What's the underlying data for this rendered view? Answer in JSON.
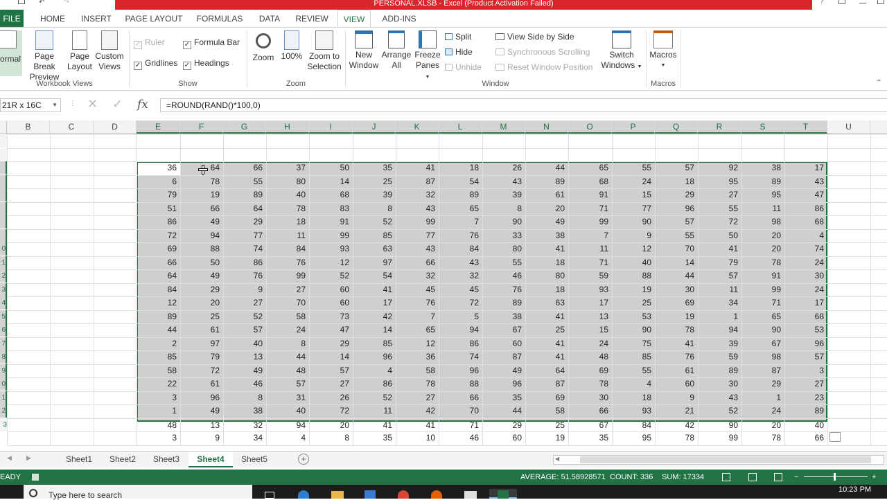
{
  "window": {
    "title": "PERSONAL.XLSB - Excel (Product Activation Failed)"
  },
  "ribbon_tabs": [
    "FILE",
    "HOME",
    "INSERT",
    "PAGE LAYOUT",
    "FORMULAS",
    "DATA",
    "REVIEW",
    "VIEW",
    "ADD-INS"
  ],
  "active_tab": "VIEW",
  "ribbon": {
    "workbook_views": {
      "label": "Workbook Views",
      "normal": "ormal",
      "page_break_1": "Page Break",
      "page_break_2": "Preview",
      "page_layout_1": "Page",
      "page_layout_2": "Layout",
      "custom_1": "Custom",
      "custom_2": "Views"
    },
    "show": {
      "label": "Show",
      "ruler": "Ruler",
      "formula_bar": "Formula Bar",
      "gridlines": "Gridlines",
      "headings": "Headings"
    },
    "zoom": {
      "label": "Zoom",
      "zoom": "Zoom",
      "hundred": "100%",
      "zoom_sel_1": "Zoom to",
      "zoom_sel_2": "Selection"
    },
    "window": {
      "label": "Window",
      "new_1": "New",
      "new_2": "Window",
      "arrange_1": "Arrange",
      "arrange_2": "All",
      "freeze_1": "Freeze",
      "freeze_2": "Panes",
      "split": "Split",
      "hide": "Hide",
      "unhide": "Unhide",
      "side_by_side": "View Side by Side",
      "sync_scroll": "Synchronous Scrolling",
      "reset_pos": "Reset Window Position",
      "switch_1": "Switch",
      "switch_2": "Windows"
    },
    "macros": {
      "label": "Macros",
      "macros": "Macros"
    }
  },
  "formula_bar": {
    "name_box": "21R x 16C",
    "formula": "=ROUND(RAND()*100,0)",
    "fx": "fx"
  },
  "columns": [
    "B",
    "C",
    "D",
    "E",
    "F",
    "G",
    "H",
    "I",
    "J",
    "K",
    "L",
    "M",
    "N",
    "O",
    "P",
    "Q",
    "R",
    "S",
    "T",
    "U"
  ],
  "row_numbers": [
    "",
    "",
    "",
    "",
    "",
    "",
    "",
    "",
    "0",
    "1",
    "2",
    "3",
    "4",
    "5",
    "6",
    "7",
    "8",
    "9",
    "0",
    "1",
    "2",
    "3"
  ],
  "data_rows": [
    [
      36,
      64,
      66,
      37,
      50,
      35,
      41,
      18,
      26,
      44,
      65,
      55,
      57,
      92,
      38,
      17
    ],
    [
      6,
      78,
      55,
      80,
      14,
      25,
      87,
      54,
      43,
      89,
      68,
      24,
      18,
      95,
      89,
      43
    ],
    [
      79,
      19,
      89,
      40,
      68,
      39,
      32,
      89,
      39,
      61,
      91,
      15,
      29,
      27,
      95,
      47
    ],
    [
      51,
      66,
      64,
      78,
      83,
      8,
      43,
      65,
      8,
      20,
      71,
      77,
      96,
      55,
      11,
      86
    ],
    [
      86,
      49,
      29,
      18,
      91,
      52,
      99,
      7,
      90,
      49,
      99,
      90,
      57,
      72,
      98,
      68
    ],
    [
      72,
      94,
      77,
      11,
      99,
      85,
      77,
      76,
      33,
      38,
      7,
      9,
      55,
      50,
      20,
      4
    ],
    [
      69,
      88,
      74,
      84,
      93,
      63,
      43,
      84,
      80,
      41,
      11,
      12,
      70,
      41,
      20,
      74
    ],
    [
      66,
      50,
      86,
      76,
      12,
      97,
      66,
      43,
      55,
      18,
      71,
      40,
      14,
      79,
      78,
      24
    ],
    [
      64,
      49,
      76,
      99,
      52,
      54,
      32,
      32,
      46,
      80,
      59,
      88,
      44,
      57,
      91,
      30
    ],
    [
      84,
      29,
      9,
      27,
      60,
      41,
      45,
      45,
      76,
      18,
      93,
      19,
      30,
      11,
      99,
      24
    ],
    [
      12,
      20,
      27,
      70,
      60,
      17,
      76,
      72,
      89,
      63,
      17,
      25,
      69,
      34,
      71,
      17
    ],
    [
      89,
      25,
      52,
      58,
      73,
      42,
      7,
      5,
      38,
      41,
      13,
      53,
      19,
      1,
      65,
      68
    ],
    [
      44,
      61,
      57,
      24,
      47,
      14,
      65,
      94,
      67,
      25,
      15,
      90,
      78,
      94,
      90,
      53
    ],
    [
      2,
      97,
      40,
      8,
      29,
      85,
      12,
      86,
      60,
      41,
      24,
      75,
      41,
      39,
      67,
      96
    ],
    [
      85,
      79,
      13,
      44,
      14,
      96,
      36,
      74,
      87,
      41,
      48,
      85,
      76,
      59,
      98,
      57
    ],
    [
      58,
      72,
      49,
      48,
      57,
      4,
      58,
      96,
      49,
      64,
      69,
      55,
      61,
      89,
      87,
      3
    ],
    [
      22,
      61,
      46,
      57,
      27,
      86,
      78,
      88,
      96,
      87,
      78,
      4,
      60,
      30,
      29,
      27
    ],
    [
      3,
      96,
      8,
      31,
      26,
      52,
      27,
      66,
      35,
      69,
      30,
      18,
      9,
      43,
      1,
      23
    ],
    [
      1,
      49,
      38,
      40,
      72,
      11,
      42,
      70,
      44,
      58,
      66,
      93,
      21,
      52,
      24,
      89
    ],
    [
      48,
      13,
      32,
      94,
      20,
      41,
      41,
      71,
      29,
      25,
      67,
      84,
      42,
      90,
      20,
      40
    ],
    [
      3,
      9,
      34,
      4,
      8,
      35,
      10,
      46,
      60,
      19,
      35,
      95,
      78,
      99,
      78,
      66
    ]
  ],
  "sheet_tabs": [
    "Sheet1",
    "Sheet2",
    "Sheet3",
    "Sheet4",
    "Sheet5"
  ],
  "active_sheet": "Sheet4",
  "status": {
    "mode": "EADY",
    "average": "AVERAGE: 51.58928571",
    "count": "COUNT: 336",
    "sum": "SUM: 17334"
  },
  "taskbar": {
    "search": "Type here to search",
    "time": "10:23 PM"
  },
  "colors": {
    "excel_green": "#217346",
    "title_red": "#d9262c"
  }
}
